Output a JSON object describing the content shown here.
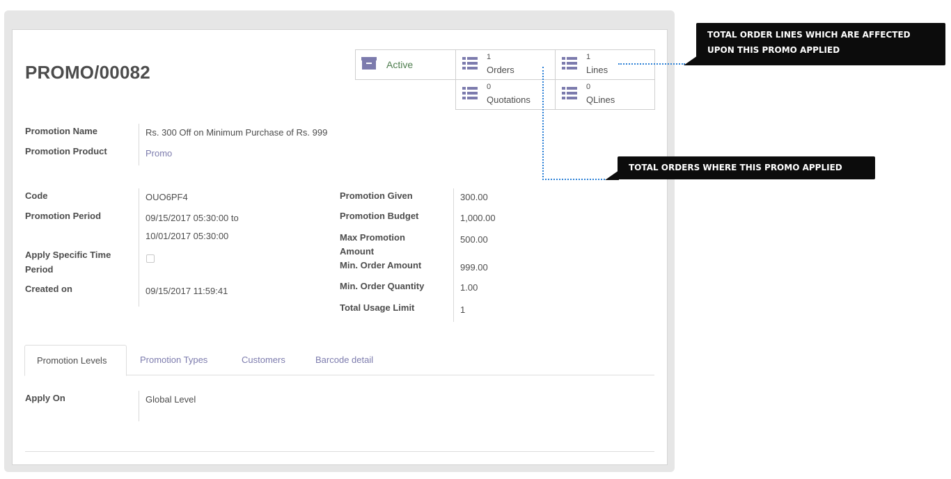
{
  "record": {
    "title": "PROMO/00082"
  },
  "smart_buttons": {
    "status": {
      "label": "Active"
    },
    "orders": {
      "value": "1",
      "label": "Orders"
    },
    "lines": {
      "value": "1",
      "label": "Lines"
    },
    "quotations": {
      "value": "0",
      "label": "Quotations"
    },
    "qlines": {
      "value": "0",
      "label": "QLines"
    }
  },
  "promotion": {
    "name_label": "Promotion Name",
    "name_value": "Rs. 300 Off on Minimum Purchase of Rs. 999",
    "product_label": "Promotion Product",
    "product_value": "Promo"
  },
  "left_fields": {
    "code_label": "Code",
    "code_value": "OUO6PF4",
    "period_label": "Promotion Period",
    "period_from": "09/15/2017 05:30:00 to",
    "period_to": "10/01/2017 05:30:00",
    "specific_time_label_1": "Apply Specific Time",
    "specific_time_label_2": "Period",
    "specific_time_checked": false,
    "created_label": "Created on",
    "created_value": "09/15/2017 11:59:41"
  },
  "right_fields": {
    "given_label": "Promotion Given",
    "given_value": "300.00",
    "budget_label": "Promotion Budget",
    "budget_value": "1,000.00",
    "max_label_1": "Max Promotion",
    "max_label_2": "Amount",
    "max_value": "500.00",
    "min_amount_label": "Min. Order Amount",
    "min_amount_value": "999.00",
    "min_qty_label": "Min. Order Quantity",
    "min_qty_value": "1.00",
    "usage_label": "Total Usage Limit",
    "usage_value": "1"
  },
  "tabs": [
    {
      "label": "Promotion Levels",
      "active": true
    },
    {
      "label": "Promotion Types",
      "active": false
    },
    {
      "label": "Customers",
      "active": false
    },
    {
      "label": "Barcode detail",
      "active": false
    }
  ],
  "tab_content": {
    "apply_on_label": "Apply On",
    "apply_on_value": "Global Level"
  },
  "callouts": {
    "lines_line1": "TOTAL ORDER LINES WHICH ARE AFFECTED",
    "lines_line2": "UPON THIS PROMO APPLIED",
    "orders": "TOTAL ORDERS WHERE THIS PROMO APPLIED"
  },
  "colors": {
    "link": "#7c7bad",
    "icon": "#7c7bad",
    "callout_bg": "#0c0c0c",
    "connector": "#2a7fd6"
  }
}
